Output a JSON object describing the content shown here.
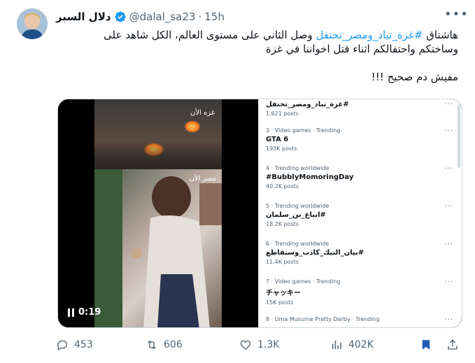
{
  "author": {
    "display_name": "دلال السبر",
    "handle": "@dalal_sa23",
    "time": "15h"
  },
  "tweet": {
    "line1_prefix": "هاشتاق ",
    "line1_hashtag": "#غزة_تباد_ومصر_تحتفل",
    "line1_suffix": " وصل الثاني على مستوى العالم، الكل شاهد على",
    "line2": "وساختكم واحتفالكم اثناء قتل اخواننا في غزة",
    "line3": "مفيش دم صحيح !!!"
  },
  "video": {
    "label_top": "غزه الأن",
    "label_bottom": "مصر الأن",
    "timestamp": "0:19"
  },
  "trends": [
    {
      "meta": "",
      "name": "#غزة_تباد_ومصر_تحتفل",
      "posts": "1,621 posts",
      "rtl": true
    },
    {
      "meta": "3 · Video games · Trending",
      "name": "GTA 6",
      "posts": "193K posts",
      "rtl": false
    },
    {
      "meta": "4 · Trending worldwide",
      "name": "#BubblyMomoringDay",
      "posts": "40.2K posts",
      "rtl": false
    },
    {
      "meta": "5 · Trending worldwide",
      "name": "#اتباع_بن_سلمان",
      "posts": "18.2K posts",
      "rtl": true
    },
    {
      "meta": "6 · Trending worldwide",
      "name": "#بيان_التيك_كاذب_وسنقاطع",
      "posts": "11.4K posts",
      "rtl": true
    },
    {
      "meta": "7 · Video games · Trending",
      "name": "チャッキー",
      "posts": "15K posts",
      "rtl": false
    },
    {
      "meta": "8 · Uma Musume Pretty Derby · Trending",
      "name": "",
      "posts": "",
      "rtl": false
    }
  ],
  "actions": {
    "replies": "453",
    "reposts": "606",
    "likes": "1.3K",
    "views": "402K"
  },
  "colors": {
    "accent": "#1d9bf0",
    "secondary_text": "#536471",
    "bookmark": "#1d5cb8"
  }
}
